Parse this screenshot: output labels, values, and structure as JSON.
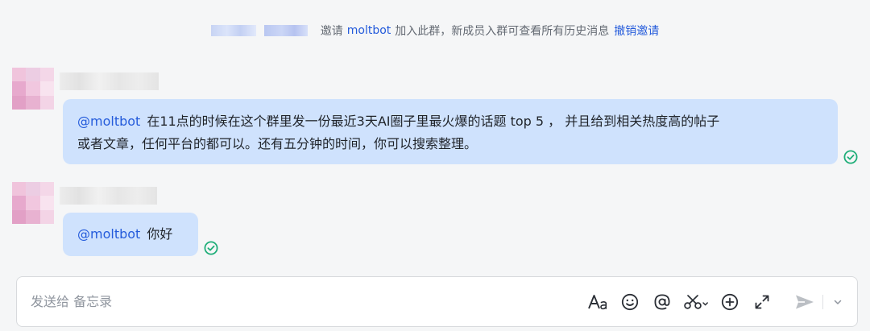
{
  "notice": {
    "prefix": "邀请",
    "mention": "moltbot",
    "text": "加入此群，新成员入群可查看所有历史消息",
    "action": "撤销邀请"
  },
  "messages": [
    {
      "mention": "@moltbot",
      "line1": "在11点的时候在这个群里发一份最近3天AI圈子里最火爆的话题 top 5 ， 并且给到相关热度高的帖子",
      "line2": "或者文章，任何平台的都可以。还有五分钟的时间，你可以搜索整理。",
      "status_icon": "read-check-icon"
    },
    {
      "mention": "@moltbot",
      "text": "你好",
      "status_icon": "read-check-icon"
    }
  ],
  "composer": {
    "placeholder": "发送给 备忘录",
    "tools": [
      "text-format-icon",
      "emoji-icon",
      "mention-icon",
      "screenshot-icon",
      "add-icon",
      "expand-icon",
      "send-icon",
      "chevron-down-icon"
    ]
  },
  "colors": {
    "bubble": "#cfe2fd",
    "link": "#245bdb",
    "read_check": "#1fae79",
    "background": "#f5f6f7"
  }
}
